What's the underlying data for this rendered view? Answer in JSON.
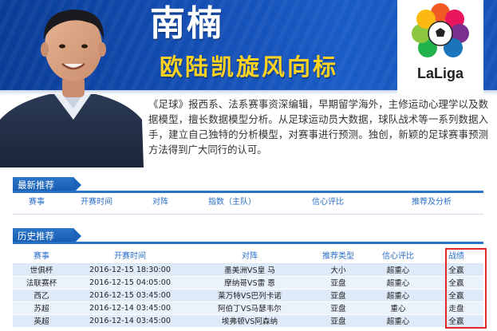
{
  "hero": {
    "name": "南楠",
    "tagline": "欧陆凯旋风向标",
    "logo_text": "LaLiga",
    "description": "《足球》报西系、法系赛事资深编辑，早期留学海外，主修运动心理学以及数据模型，擅长数据模型分析。从足球运动员大数据，球队战术等一系列数据入手，建立自己独特的分析模型，对赛事进行预测。独创，新颖的足球赛事预测方法得到广大同行的认可。"
  },
  "latest": {
    "title": "最新推荐",
    "columns": [
      "赛事",
      "开赛时间",
      "对阵",
      "指数（主队）",
      "信心评比",
      "推荐及分析"
    ]
  },
  "history": {
    "title": "历史推荐",
    "columns": [
      "赛事",
      "开赛时间",
      "对阵",
      "推荐类型",
      "信心评比",
      "战绩"
    ],
    "rows": [
      {
        "league": "世俱杯",
        "time": "2016-12-15 18:30:00",
        "match": "墨美洲VS皇 马",
        "type": "大小",
        "confidence": "超重心",
        "result": "全赢"
      },
      {
        "league": "法联赛杯",
        "time": "2016-12-15 04:05:00",
        "match": "摩纳哥VS雷 恩",
        "type": "亚盘",
        "confidence": "超重心",
        "result": "全赢"
      },
      {
        "league": "西乙",
        "time": "2016-12-15 03:45:00",
        "match": "莱万特VS巴列卡诺",
        "type": "亚盘",
        "confidence": "超重心",
        "result": "全赢"
      },
      {
        "league": "苏超",
        "time": "2016-12-14 03:45:00",
        "match": "阿伯丁VS马瑟韦尔",
        "type": "亚盘",
        "confidence": "重心",
        "result": "走盘"
      },
      {
        "league": "英超",
        "time": "2016-12-14 03:45:00",
        "match": "埃弗顿VS阿森纳",
        "type": "亚盘",
        "confidence": "超重心",
        "result": "全赢"
      }
    ]
  }
}
